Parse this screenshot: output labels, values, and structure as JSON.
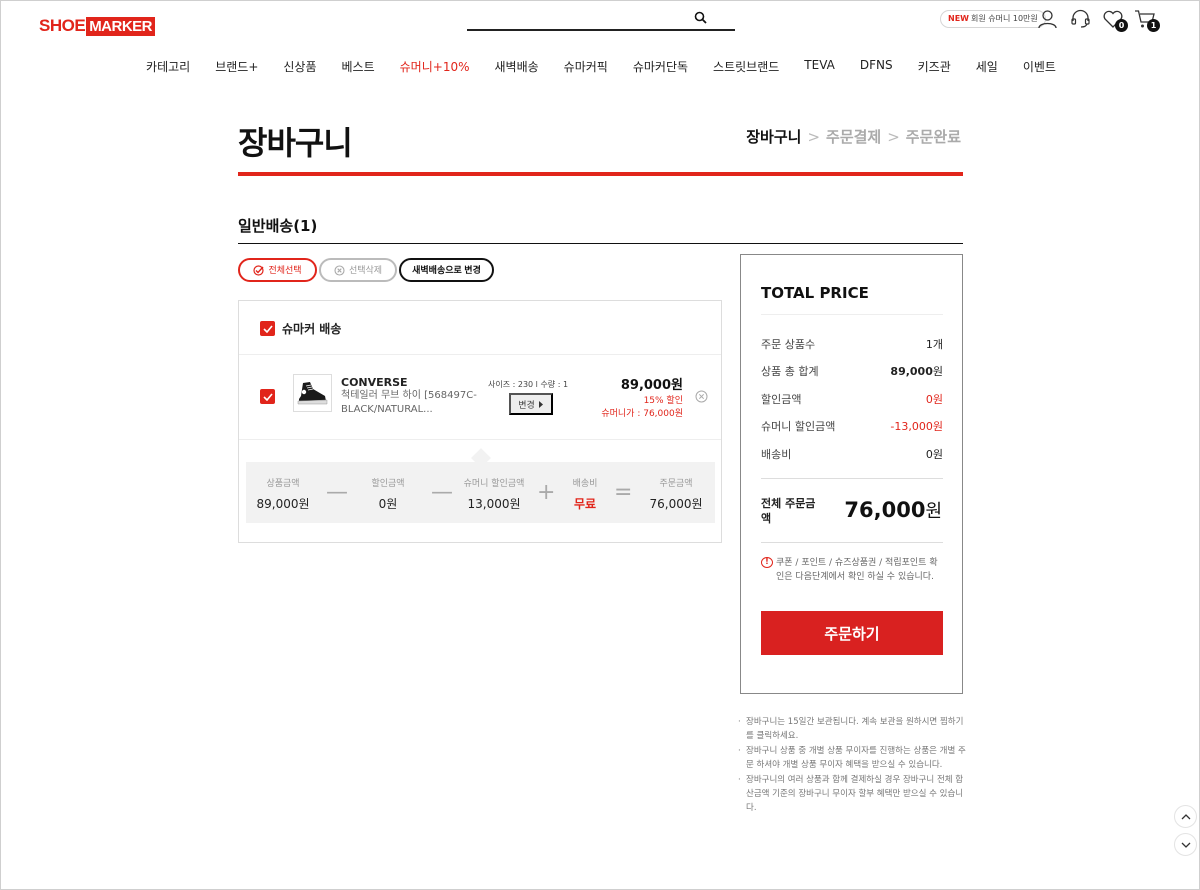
{
  "header": {
    "logo_shoe": "SHOE",
    "logo_marker": "MARKER",
    "badge_new": "NEW",
    "badge_text": "회원 슈머니 10만원",
    "wishlist_count": "0",
    "cart_count": "1"
  },
  "nav": [
    {
      "label": "카테고리",
      "hot": false
    },
    {
      "label": "브랜드+",
      "hot": false
    },
    {
      "label": "신상품",
      "hot": false
    },
    {
      "label": "베스트",
      "hot": false
    },
    {
      "label": "슈머니+10%",
      "hot": true
    },
    {
      "label": "새벽배송",
      "hot": false
    },
    {
      "label": "슈마커픽",
      "hot": false
    },
    {
      "label": "슈마커단독",
      "hot": false
    },
    {
      "label": "스트릿브랜드",
      "hot": false
    },
    {
      "label": "TEVA",
      "hot": false
    },
    {
      "label": "DFNS",
      "hot": false
    },
    {
      "label": "키즈관",
      "hot": false
    },
    {
      "label": "세일",
      "hot": false
    },
    {
      "label": "이벤트",
      "hot": false
    }
  ],
  "page": {
    "title": "장바구니",
    "step_current": "장바구니",
    "step_2": "주문결제",
    "step_3": "주문완료",
    "step_sep": ">"
  },
  "section": {
    "title": "일반배송(1)",
    "select_all": "전체선택",
    "delete_selected": "선택삭제",
    "change_dawn": "새벽배송으로 변경",
    "group_label": "슈마커 배송"
  },
  "item": {
    "brand": "CONVERSE",
    "name": "척테일러 무브 하이 [568497C-BLACK/NATURAL...",
    "option": "사이즈 : 230 l 수량 : 1",
    "change_label": "변경",
    "price": "89,000원",
    "discount": "15% 할인",
    "shoemoney_price": "슈머니가 : 76,000원"
  },
  "summary": {
    "product_label": "상품금액",
    "product_value": "89,000원",
    "discount_label": "할인금액",
    "discount_value": "0원",
    "sm_label": "슈머니 할인금액",
    "sm_value": "13,000원",
    "ship_label": "배송비",
    "ship_value": "무료",
    "order_label": "주문금액",
    "order_value": "76,000원",
    "op_minus": "—",
    "op_plus": "+",
    "op_equal": "="
  },
  "total": {
    "title": "TOTAL PRICE",
    "rows": [
      {
        "label": "주문 상품수",
        "value": "1개"
      },
      {
        "label": "상품 총 합계",
        "value_num": "89,000",
        "value_unit": "원"
      },
      {
        "label": "할인금액",
        "value": "0원"
      },
      {
        "label": "슈머니 할인금액",
        "value": "-13,000원"
      },
      {
        "label": "배송비",
        "value": "0원"
      }
    ],
    "total_label": "전체 주문금액",
    "total_value": "76,000",
    "total_unit": "원",
    "note": "쿠폰 / 포인트 / 슈즈상품권 / 적립포인트 확인은 다음단계에서 확인 하실 수 있습니다.",
    "order_button": "주문하기"
  },
  "notes": [
    "장바구니는 15일간 보관됩니다. 계속 보관을 원하시면 찜하기를 클릭하세요.",
    "장바구니 상품 중 개별 상품 무이자를 진행하는 상품은 개별 주문 하셔야 개별 상품 무이자 혜택을 받으실 수 있습니다.",
    "장바구니의 여러 상품과 함께 결제하실 경우 장바구니 전체 합산금액 기준의 장바구니 무이자 할부 혜택만 받으실 수 있습니다."
  ],
  "colors": {
    "accent": "#e1251b",
    "order_button": "#d92120"
  }
}
